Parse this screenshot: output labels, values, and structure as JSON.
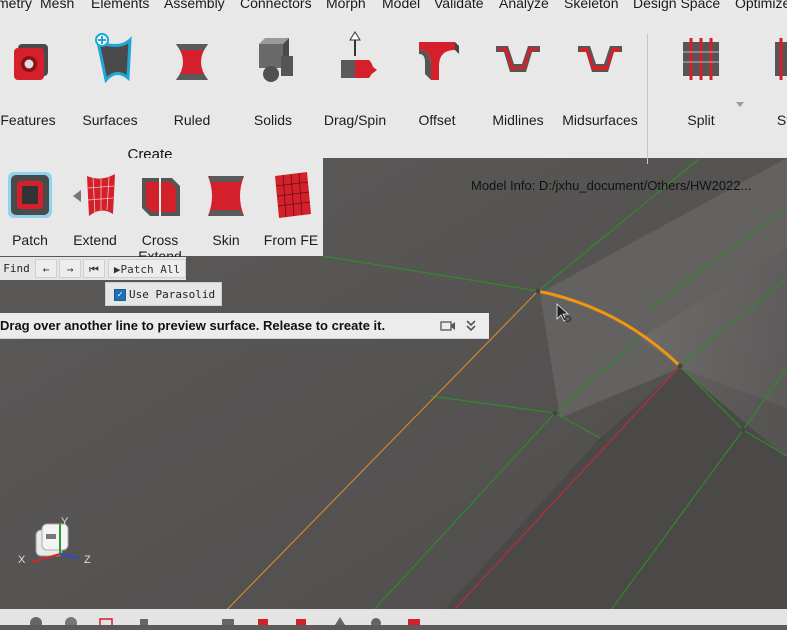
{
  "menubar": {
    "items": [
      "metry",
      "Mesh",
      "Elements",
      "Assembly",
      "Connectors",
      "Morph",
      "Model",
      "Validate",
      "Analyze",
      "Skeleton",
      "Design Space",
      "Optimize"
    ]
  },
  "ribbon": {
    "tools": [
      {
        "label": "Features",
        "icon": "features-icon"
      },
      {
        "label": "Surfaces",
        "icon": "surfaces-icon"
      },
      {
        "label": "Ruled",
        "icon": "ruled-icon"
      },
      {
        "label": "Solids",
        "icon": "solids-icon"
      },
      {
        "label": "Drag/Spin",
        "icon": "drag-spin-icon"
      },
      {
        "label": "Offset",
        "icon": "offset-icon"
      },
      {
        "label": "Midlines",
        "icon": "midlines-icon"
      },
      {
        "label": "Midsurfaces",
        "icon": "midsurfaces-icon"
      },
      {
        "label": "Split",
        "icon": "split-icon"
      },
      {
        "label": "Stit",
        "icon": "stitch-icon"
      }
    ],
    "group_title": "Create"
  },
  "subpanel": {
    "tools": [
      {
        "label": "Patch",
        "icon": "patch-icon"
      },
      {
        "label": "Extend",
        "icon": "extend-icon"
      },
      {
        "label": "Cross Extend",
        "icon": "cross-extend-icon"
      },
      {
        "label": "Skin",
        "icon": "skin-icon"
      },
      {
        "label": "From FE",
        "icon": "from-fe-icon"
      }
    ]
  },
  "findbar": {
    "find_label": "Find",
    "back_symbol": "←",
    "forward_symbol": "→",
    "first_symbol": "⏮",
    "patch_all_label": "▶Patch All"
  },
  "options": {
    "use_parasolid_label": "Use Parasolid",
    "use_parasolid_checked": true
  },
  "hint": {
    "text": "Drag over another line to preview surface. Release to create it."
  },
  "viewport": {
    "model_info": "Model Info: D:/jxhu_document/Others/HW2022...",
    "axes": {
      "y": "Y",
      "x": "X",
      "z": "Z"
    }
  },
  "colors": {
    "accent_red": "#d4202a",
    "highlight_cyan": "#1fa7d8",
    "edge_green": "#2f8a2a",
    "edge_orange": "#e08a16",
    "viewport_bg": "#5d5b5a"
  }
}
